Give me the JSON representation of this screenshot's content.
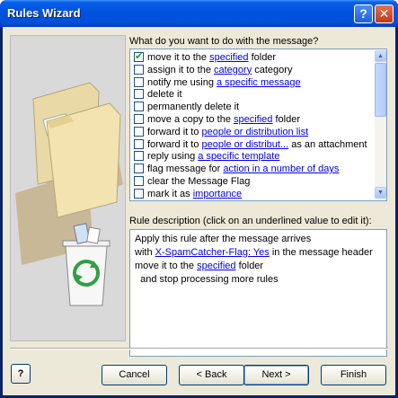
{
  "window": {
    "title": "Rules Wizard"
  },
  "titlebar": {
    "help_glyph": "?",
    "close_glyph": "✕"
  },
  "prompt": "What do you want to do with the message?",
  "actions": [
    {
      "checked": true,
      "pre": "move it to the ",
      "link": "specified",
      "post": " folder"
    },
    {
      "checked": false,
      "pre": "assign it to the ",
      "link": "category",
      "post": " category"
    },
    {
      "checked": false,
      "pre": "notify me using ",
      "link": "a specific message",
      "post": ""
    },
    {
      "checked": false,
      "pre": "delete it",
      "link": "",
      "post": ""
    },
    {
      "checked": false,
      "pre": "permanently delete it",
      "link": "",
      "post": ""
    },
    {
      "checked": false,
      "pre": "move a copy to the ",
      "link": "specified",
      "post": " folder"
    },
    {
      "checked": false,
      "pre": "forward it to ",
      "link": "people or distribution list",
      "post": ""
    },
    {
      "checked": false,
      "pre": "forward it to ",
      "link": "people or distribut...",
      "post": " as an attachment"
    },
    {
      "checked": false,
      "pre": "reply using ",
      "link": "a specific template",
      "post": ""
    },
    {
      "checked": false,
      "pre": "flag message for ",
      "link": "action in a number of days",
      "post": ""
    },
    {
      "checked": false,
      "pre": "clear the Message Flag",
      "link": "",
      "post": ""
    },
    {
      "checked": false,
      "pre": "mark it as ",
      "link": "importance",
      "post": ""
    }
  ],
  "description": {
    "label": "Rule description (click on an underlined value to edit it):",
    "line1": "Apply this rule after the message arrives",
    "line2_pre": "with ",
    "line2_link": "X-SpamCatcher-Flag: Yes",
    "line2_post": "  in the message header",
    "line3_pre": "move it to the ",
    "line3_link": "specified",
    "line3_post": " folder",
    "line4": "  and stop processing more rules"
  },
  "buttons": {
    "help": "?",
    "cancel": "Cancel",
    "back": "< Back",
    "next": "Next >",
    "finish": "Finish"
  },
  "colors": {
    "title_bar": "#0053e0",
    "link": "#0000ee",
    "check": "#21a121",
    "recycle": "#2ea043"
  }
}
